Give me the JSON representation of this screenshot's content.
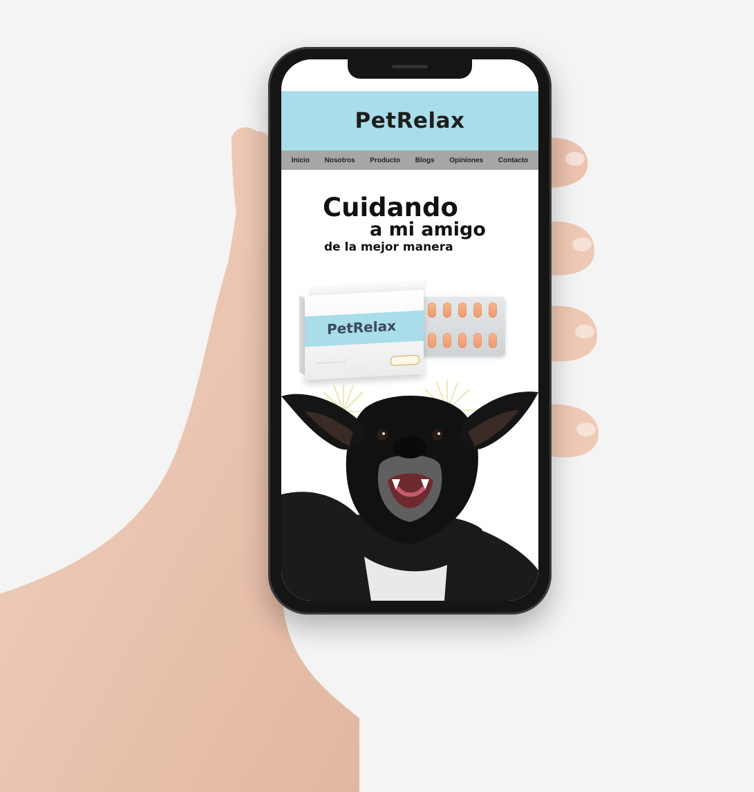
{
  "site": {
    "title": "PetRelax",
    "nav": [
      "Inicio",
      "Nosotros",
      "Producto",
      "Blogs",
      "Opiniones",
      "Contacto"
    ]
  },
  "hero": {
    "line1": "Cuidando",
    "line2": "a mi amigo",
    "line3": "de la mejor manera"
  },
  "product": {
    "brand": "PetRelax"
  },
  "colors": {
    "header": "#a8dde9",
    "nav": "#a6a6a6",
    "pill": "#f2a57c"
  }
}
